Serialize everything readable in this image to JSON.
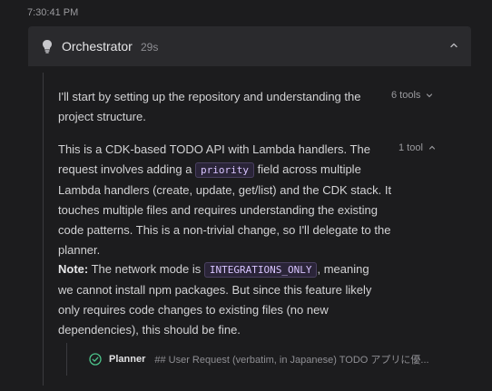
{
  "timestamp": "7:30:41 PM",
  "orchestrator": {
    "title": "Orchestrator",
    "duration": "29s"
  },
  "messages": [
    {
      "text": "I'll start by setting up the repository and understanding the project structure.",
      "tools": "6 tools"
    },
    {
      "text_before_code": "This is a CDK-based TODO API with Lambda handlers. The request involves adding a ",
      "code": "priority",
      "text_after_code": " field across multiple Lambda handlers (create, update, get/list) and the CDK stack. It touches multiple files and requires understanding the existing code patterns. This is a non-trivial change, so I'll delegate to the planner.",
      "tools": "1 tool"
    }
  ],
  "note": {
    "label": "Note:",
    "text_before_code": " The network mode is ",
    "code": "INTEGRATIONS_ONLY",
    "text_after_code": ", meaning we cannot install npm packages. But since this feature likely only requires code changes to existing files (no new dependencies), this should be fine."
  },
  "subagent": {
    "name": "Planner",
    "preview": "## User Request (verbatim, in Japanese) TODO アプリに優..."
  },
  "icons": {
    "header": "lightbulb-icon",
    "collapse": "chevron-up-icon",
    "tools_collapsed": "chevron-down-icon",
    "tools_expanded": "chevron-up-icon",
    "status": "check-circle-icon"
  },
  "colors": {
    "background": "#1c1c1e",
    "header_background": "#2a2a2d",
    "code_text": "#d8c4ff",
    "success": "#4cc38a"
  }
}
